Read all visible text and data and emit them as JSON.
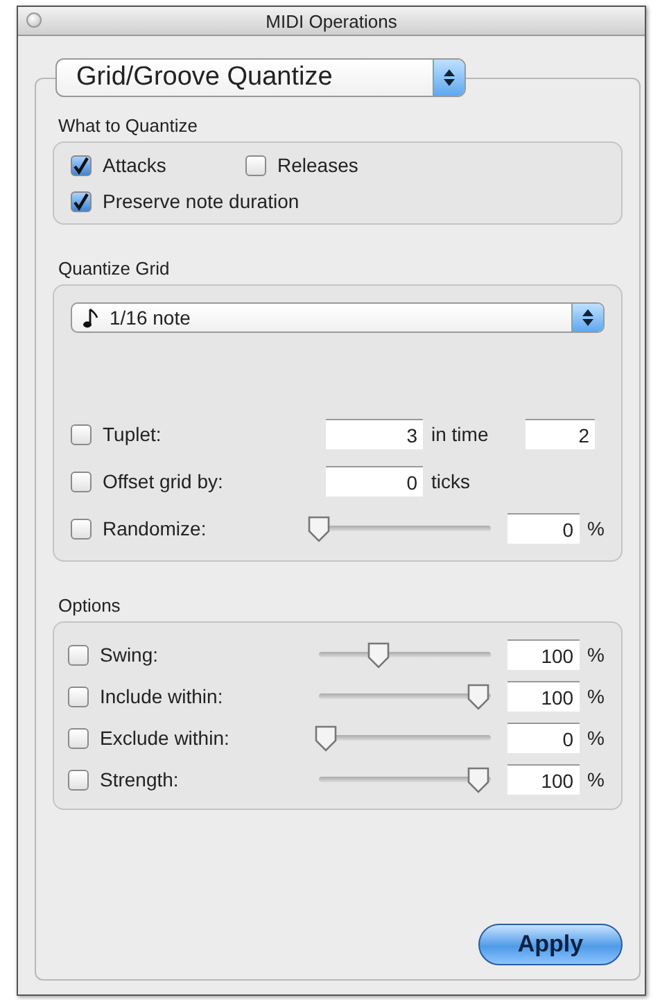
{
  "window": {
    "title": "MIDI Operations"
  },
  "operation_menu": {
    "value": "Grid/Groove Quantize"
  },
  "what_to_quantize": {
    "title": "What to Quantize",
    "options": [
      {
        "label": "Attacks",
        "checked": true
      },
      {
        "label": "Releases",
        "checked": false
      },
      {
        "label": "Preserve note duration",
        "checked": true
      }
    ]
  },
  "quantize_grid": {
    "title": "Quantize Grid",
    "grid_menu": {
      "value": "1/16 note"
    },
    "rows": [
      {
        "kind": "pair",
        "label": "Tuplet:",
        "checked": false,
        "value": "3",
        "middle": "in time",
        "value2": "2"
      },
      {
        "kind": "unit",
        "label": "Offset grid by:",
        "checked": false,
        "value": "0",
        "unit": "ticks"
      },
      {
        "kind": "slider",
        "label": "Randomize:",
        "checked": false,
        "level": 0,
        "value": "0",
        "unit": "%"
      }
    ]
  },
  "options": {
    "title": "Options",
    "rows": [
      {
        "kind": "slider",
        "label": "Swing:",
        "checked": false,
        "level": 0.35,
        "value": "100",
        "unit": "%"
      },
      {
        "kind": "slider",
        "label": "Include within:",
        "checked": false,
        "level": 0.93,
        "value": "100",
        "unit": "%"
      },
      {
        "kind": "slider",
        "label": "Exclude within:",
        "checked": false,
        "level": 0.04,
        "value": "0",
        "unit": "%"
      },
      {
        "kind": "slider",
        "label": "Strength:",
        "checked": false,
        "level": 0.93,
        "value": "100",
        "unit": "%"
      }
    ]
  },
  "apply_button": {
    "label": "Apply"
  }
}
